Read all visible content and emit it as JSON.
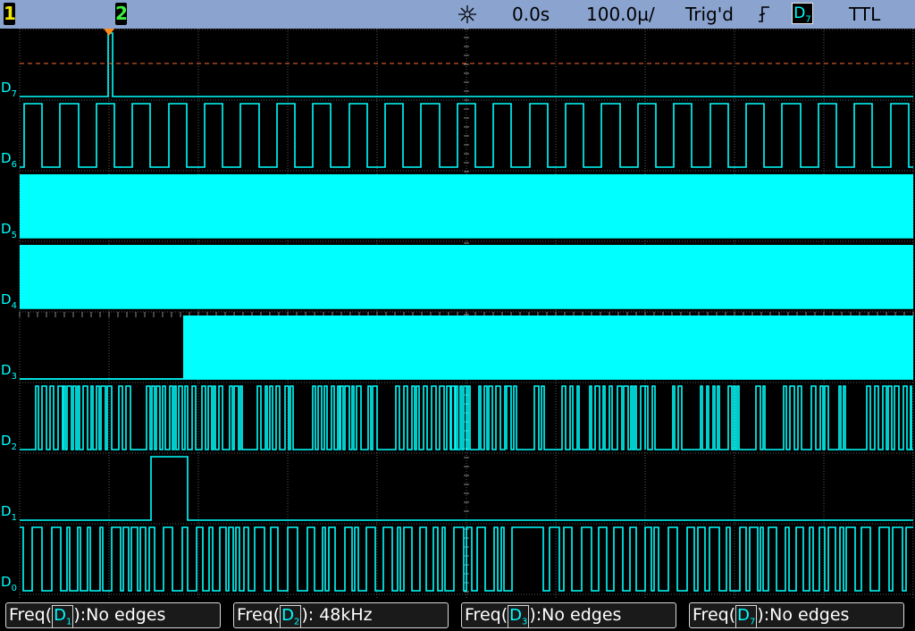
{
  "topbar": {
    "channel1": "1",
    "channel2": "2",
    "run_icon": "acquire-starburst-icon",
    "time_offset": "0.0s",
    "time_scale": "100.0µ/",
    "trigger_status": "Trig'd",
    "trigger_edge_icon": "rising-edge-icon",
    "trigger_source_letter": "D",
    "trigger_source_sub": "7",
    "trigger_level": "TTL"
  },
  "channels": [
    {
      "label": "D",
      "sub": "7",
      "activity": "single pulse"
    },
    {
      "label": "D",
      "sub": "6",
      "activity": "square wave"
    },
    {
      "label": "D",
      "sub": "5",
      "activity": "dense activity"
    },
    {
      "label": "D",
      "sub": "4",
      "activity": "dense activity"
    },
    {
      "label": "D",
      "sub": "3",
      "activity": "idle low then dense activity"
    },
    {
      "label": "D",
      "sub": "2",
      "activity": "bursts"
    },
    {
      "label": "D",
      "sub": "1",
      "activity": "single pulse"
    },
    {
      "label": "D",
      "sub": "0",
      "activity": "random toggling"
    }
  ],
  "measurements": [
    {
      "prefix": "Freq(",
      "src": "D",
      "sub": "1",
      "suffix": "):No edges"
    },
    {
      "prefix": "Freq(",
      "src": "D",
      "sub": "2",
      "suffix": "): 48kHz"
    },
    {
      "prefix": "Freq(",
      "src": "D",
      "sub": "3",
      "suffix": "):No edges"
    },
    {
      "prefix": "Freq(",
      "src": "D",
      "sub": "7",
      "suffix": "):No edges"
    }
  ],
  "colors": {
    "trace": "#00ffff",
    "topbar": "#8ba3cf",
    "grid": "#5a5a5a",
    "trigger_marker": "#ff8c1a",
    "trigger_level_line": "#ff6a3a",
    "channel1": "#f2e600",
    "channel2": "#3cf03c"
  }
}
